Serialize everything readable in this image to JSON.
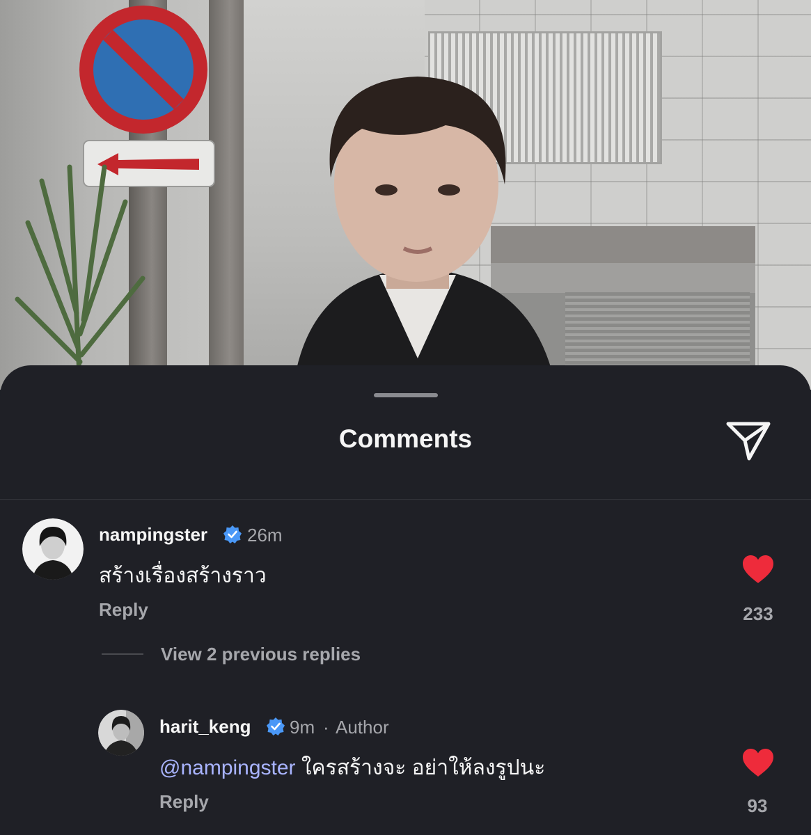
{
  "sheet": {
    "title": "Comments"
  },
  "comments": [
    {
      "username": "nampingster",
      "time": "26m",
      "text": "สร้างเรื่องสร้างราว",
      "reply_label": "Reply",
      "likes": "233"
    }
  ],
  "view_replies_label": "View 2 previous replies",
  "replies": [
    {
      "username": "harit_keng",
      "time": "9m",
      "separator": "·",
      "author_badge": "Author",
      "mention": "@nampingster",
      "text": " ใครสร้างจะ อย่าให้ลงรูปนะ",
      "reply_label": "Reply",
      "likes": "93"
    }
  ],
  "icons": {
    "share": "paper-plane-icon",
    "verified": "verified-badge-icon",
    "like": "heart-icon"
  },
  "colors": {
    "sheet_bg": "#1f2026",
    "like_red": "#ee2b3b",
    "verified_blue": "#4a98f7",
    "mention": "#a9b4ff",
    "muted": "#a6a7ac"
  }
}
